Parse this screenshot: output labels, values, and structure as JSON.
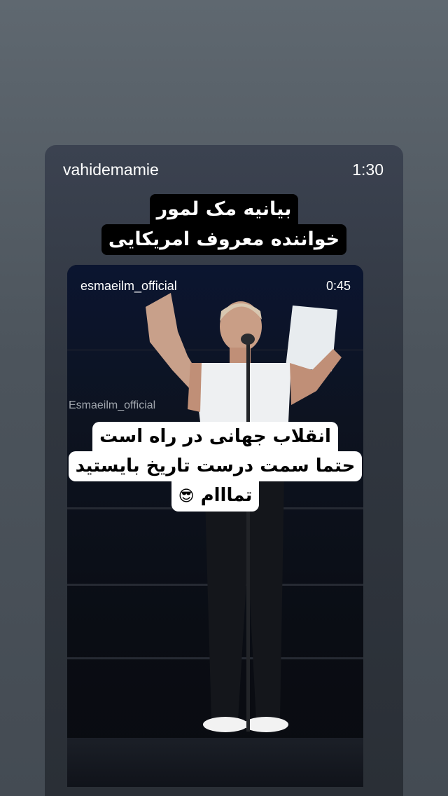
{
  "story": {
    "username": "vahidemamie",
    "duration": "1:30",
    "caption": {
      "line1": "بیانیه مک لمور",
      "line2": "خواننده معروف امریکایی"
    }
  },
  "embedded_video": {
    "username": "esmaeilm_official",
    "duration": "0:45",
    "watermark": "Esmaeilm_official",
    "caption": {
      "line1": "انقلاب جهانی در راه است",
      "line2": "حتما سمت درست تاریخ بایستید",
      "line3": "تمااام",
      "emoji": "😎"
    }
  }
}
